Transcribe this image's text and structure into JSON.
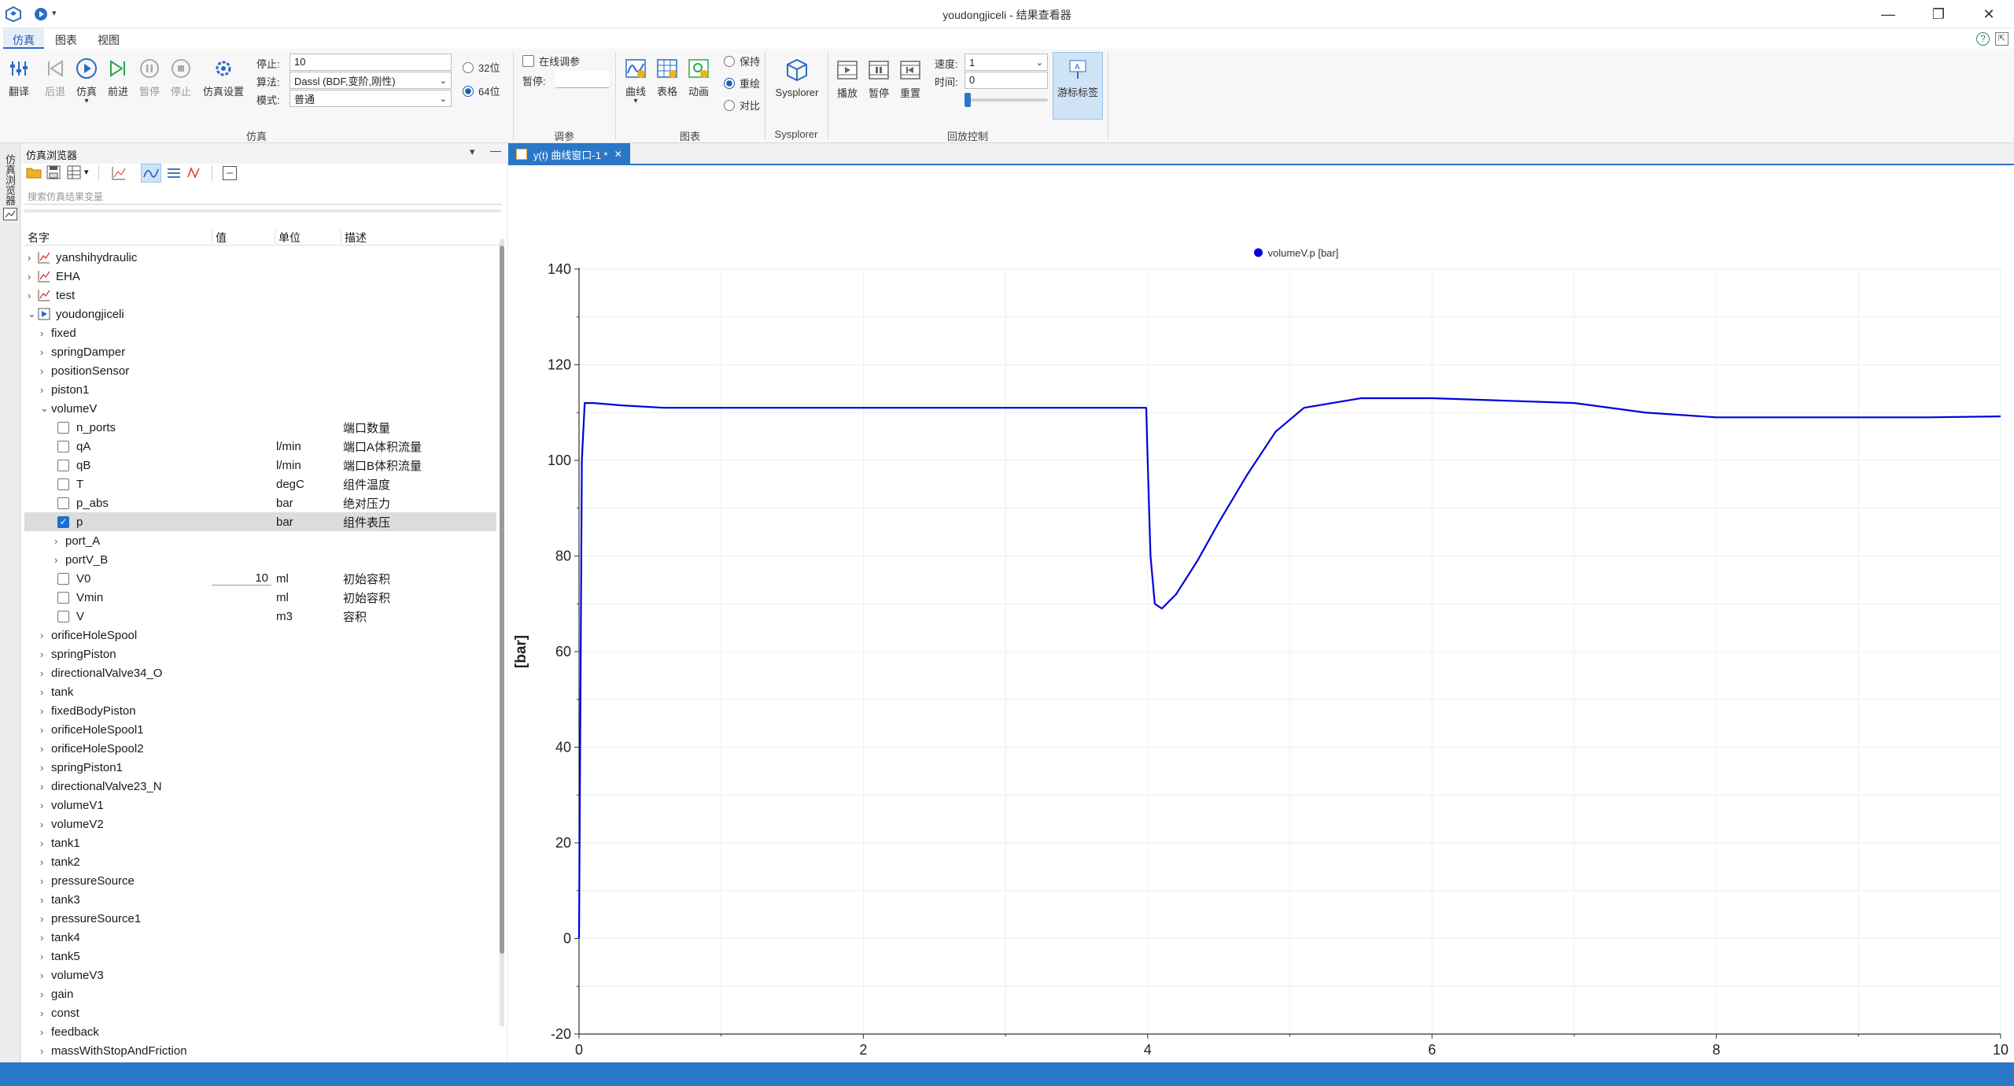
{
  "window": {
    "title": "youdongjiceli - 结果查看器"
  },
  "menu": {
    "tabs": [
      "仿真",
      "图表",
      "视图"
    ],
    "active": 0
  },
  "ribbon": {
    "sim_buttons": [
      "翻译",
      "后退",
      "仿真",
      "前进",
      "暂停",
      "停止",
      "仿真设置"
    ],
    "stop_label": "停止:",
    "stop_value": "10",
    "algo_label": "算法:",
    "algo_value": "Dassl (BDF,变阶,刚性)",
    "mode_label": "模式:",
    "mode_value": "普通",
    "bits": [
      "32位",
      "64位"
    ],
    "group_sim": "仿真",
    "online_tune": "在线调参",
    "pause_label": "暂停:",
    "group_tune": "调参",
    "chart_buttons": [
      "曲线",
      "表格",
      "动画"
    ],
    "plot_modes": [
      "保持",
      "重绘",
      "对比"
    ],
    "group_chart": "图表",
    "sysplorer": "Sysplorer",
    "group_sysplorer": "Sysplorer",
    "playback_buttons": [
      "播放",
      "暂停",
      "重置"
    ],
    "speed_label": "速度:",
    "speed_value": "1",
    "time_label": "时间:",
    "time_value": "0",
    "cursor_label": "游标标签",
    "group_playback": "回放控制"
  },
  "sidestrip": {
    "label": "仿真浏览器"
  },
  "browser": {
    "title": "仿真浏览器",
    "search_placeholder": "搜索仿真结果变量",
    "columns": [
      "名字",
      "值",
      "单位",
      "描述"
    ],
    "rows": [
      {
        "name": "yanshihydraulic",
        "level": 0,
        "expand": "closed",
        "icon": "plot"
      },
      {
        "name": "EHA",
        "level": 0,
        "expand": "closed",
        "icon": "plot"
      },
      {
        "name": "test",
        "level": 0,
        "expand": "closed",
        "icon": "plot"
      },
      {
        "name": "youdongjiceli",
        "level": 0,
        "expand": "open",
        "icon": "sim"
      },
      {
        "name": "fixed",
        "level": 1,
        "expand": "closed"
      },
      {
        "name": "springDamper",
        "level": 1,
        "expand": "closed"
      },
      {
        "name": "positionSensor",
        "level": 1,
        "expand": "closed"
      },
      {
        "name": "piston1",
        "level": 1,
        "expand": "closed"
      },
      {
        "name": "volumeV",
        "level": 1,
        "expand": "open"
      },
      {
        "name": "n_ports",
        "level": 2,
        "check": false,
        "unit": "",
        "desc": "端口数量"
      },
      {
        "name": "qA",
        "level": 2,
        "check": false,
        "unit": "l/min",
        "desc": "端口A体积流量"
      },
      {
        "name": "qB",
        "level": 2,
        "check": false,
        "unit": "l/min",
        "desc": "端口B体积流量"
      },
      {
        "name": "T",
        "level": 2,
        "check": false,
        "unit": "degC",
        "desc": "组件温度"
      },
      {
        "name": "p_abs",
        "level": 2,
        "check": false,
        "unit": "bar",
        "desc": "绝对压力"
      },
      {
        "name": "p",
        "level": 2,
        "check": true,
        "unit": "bar",
        "desc": "组件表压",
        "selected": true
      },
      {
        "name": "port_A",
        "level": 2,
        "expand": "closed"
      },
      {
        "name": "portV_B",
        "level": 2,
        "expand": "closed"
      },
      {
        "name": "V0",
        "level": 2,
        "check": false,
        "value": "10",
        "unit": "ml",
        "desc": "初始容积"
      },
      {
        "name": "Vmin",
        "level": 2,
        "check": false,
        "unit": "ml",
        "desc": "初始容积"
      },
      {
        "name": "V",
        "level": 2,
        "check": false,
        "unit": "m3",
        "desc": "容积"
      },
      {
        "name": "orificeHoleSpool",
        "level": 1,
        "expand": "closed"
      },
      {
        "name": "springPiston",
        "level": 1,
        "expand": "closed"
      },
      {
        "name": "directionalValve34_O",
        "level": 1,
        "expand": "closed"
      },
      {
        "name": "tank",
        "level": 1,
        "expand": "closed"
      },
      {
        "name": "fixedBodyPiston",
        "level": 1,
        "expand": "closed"
      },
      {
        "name": "orificeHoleSpool1",
        "level": 1,
        "expand": "closed"
      },
      {
        "name": "orificeHoleSpool2",
        "level": 1,
        "expand": "closed"
      },
      {
        "name": "springPiston1",
        "level": 1,
        "expand": "closed"
      },
      {
        "name": "directionalValve23_N",
        "level": 1,
        "expand": "closed"
      },
      {
        "name": "volumeV1",
        "level": 1,
        "expand": "closed"
      },
      {
        "name": "volumeV2",
        "level": 1,
        "expand": "closed"
      },
      {
        "name": "tank1",
        "level": 1,
        "expand": "closed"
      },
      {
        "name": "tank2",
        "level": 1,
        "expand": "closed"
      },
      {
        "name": "pressureSource",
        "level": 1,
        "expand": "closed"
      },
      {
        "name": "tank3",
        "level": 1,
        "expand": "closed"
      },
      {
        "name": "pressureSource1",
        "level": 1,
        "expand": "closed"
      },
      {
        "name": "tank4",
        "level": 1,
        "expand": "closed"
      },
      {
        "name": "tank5",
        "level": 1,
        "expand": "closed"
      },
      {
        "name": "volumeV3",
        "level": 1,
        "expand": "closed"
      },
      {
        "name": "gain",
        "level": 1,
        "expand": "closed"
      },
      {
        "name": "const",
        "level": 1,
        "expand": "closed"
      },
      {
        "name": "feedback",
        "level": 1,
        "expand": "closed"
      },
      {
        "name": "massWithStopAndFriction",
        "level": 1,
        "expand": "closed"
      }
    ]
  },
  "doc_tab": {
    "label": "y(t) 曲线窗口-1 *"
  },
  "colors": {
    "accent": "#2b77c7",
    "series": "#0000dd"
  },
  "chart_data": {
    "type": "line",
    "ylabel": "[bar]",
    "xlim": [
      0,
      10
    ],
    "ylim": [
      -20,
      140
    ],
    "xticks": [
      0,
      2,
      4,
      6,
      8,
      10
    ],
    "yticks": [
      -20,
      0,
      20,
      40,
      60,
      80,
      100,
      120,
      140
    ],
    "grid": true,
    "legend": "top-center",
    "series": [
      {
        "name": "volumeV.p [bar]",
        "color": "#0000dd",
        "x": [
          0,
          0.01,
          0.02,
          0.04,
          0.1,
          0.3,
          0.6,
          1.0,
          2.0,
          3.0,
          3.99,
          4.0,
          4.02,
          4.05,
          4.1,
          4.2,
          4.35,
          4.5,
          4.7,
          4.9,
          5.1,
          5.5,
          6.0,
          6.5,
          7.0,
          7.5,
          8.0,
          8.5,
          9.0,
          9.5,
          10.0
        ],
        "y": [
          0,
          50,
          100,
          112,
          112,
          111.5,
          111,
          111,
          111,
          111,
          111,
          100,
          80,
          70,
          69,
          72,
          79,
          87,
          97,
          106,
          111,
          113,
          113,
          112.5,
          112,
          110,
          109,
          109,
          109,
          109,
          109.2
        ]
      }
    ]
  }
}
